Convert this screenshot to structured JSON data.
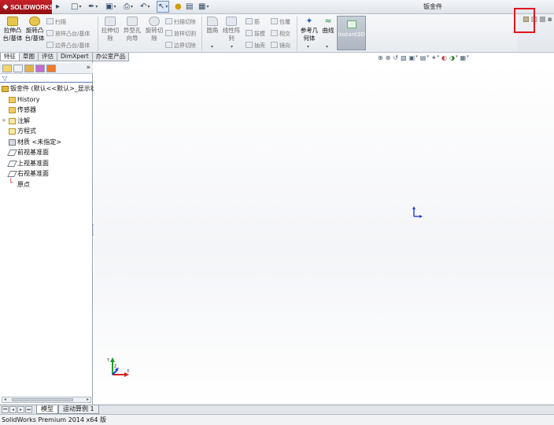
{
  "app": {
    "logo_text": "SOLIDWORKS",
    "document_title": "钣金件"
  },
  "ribbon": {
    "extruded_boss": "拉伸凸台/基体",
    "revolved_boss": "旋转凸台/基体",
    "swept_boss": "扫描",
    "lofted_boss": "放样凸台/基体",
    "boundary_boss": "边界凸台/基体",
    "extruded_cut": "拉伸切除",
    "hole_wizard": "异型孔向导",
    "revolved_cut": "旋转切除",
    "swept_cut": "扫描切除",
    "lofted_cut": "放样切割",
    "boundary_cut": "边界切除",
    "fillet": "圆角",
    "linear_pattern": "线性阵列",
    "rib": "筋",
    "draft": "拔模",
    "shell": "抽壳",
    "wrap": "包覆",
    "intersect": "相交",
    "mirror": "镜向",
    "reference_geometry": "参考几何体",
    "curves": "曲线",
    "instant3d": "Instant3D"
  },
  "tabs": [
    "特征",
    "草图",
    "评估",
    "DimXpert",
    "办公室产品"
  ],
  "feature_tree": {
    "root": "钣金件 (默认<<默认>_显示状",
    "items": [
      {
        "label": "History",
        "icon": "history-folder-icon"
      },
      {
        "label": "传感器",
        "icon": "sensors-folder-icon"
      },
      {
        "label": "注解",
        "icon": "annotations-icon"
      },
      {
        "label": "方程式",
        "icon": "equations-icon"
      },
      {
        "label": "材质 <未指定>",
        "icon": "material-icon"
      },
      {
        "label": "前视基准面",
        "icon": "plane-icon"
      },
      {
        "label": "上视基准面",
        "icon": "plane-icon"
      },
      {
        "label": "右视基准面",
        "icon": "plane-icon"
      },
      {
        "label": "原点",
        "icon": "origin-icon"
      }
    ]
  },
  "bottom_tabs": {
    "model": "模型",
    "motion_study": "运动算例 1"
  },
  "status": {
    "text": "SolidWorks Premium 2014 x64 版"
  },
  "colors": {
    "logo_red": "#b5171e",
    "highlight_red": "#e2161f",
    "axis_x": "#d32020",
    "axis_y": "#1f9a2c",
    "axis_z": "#1f3fd1"
  }
}
